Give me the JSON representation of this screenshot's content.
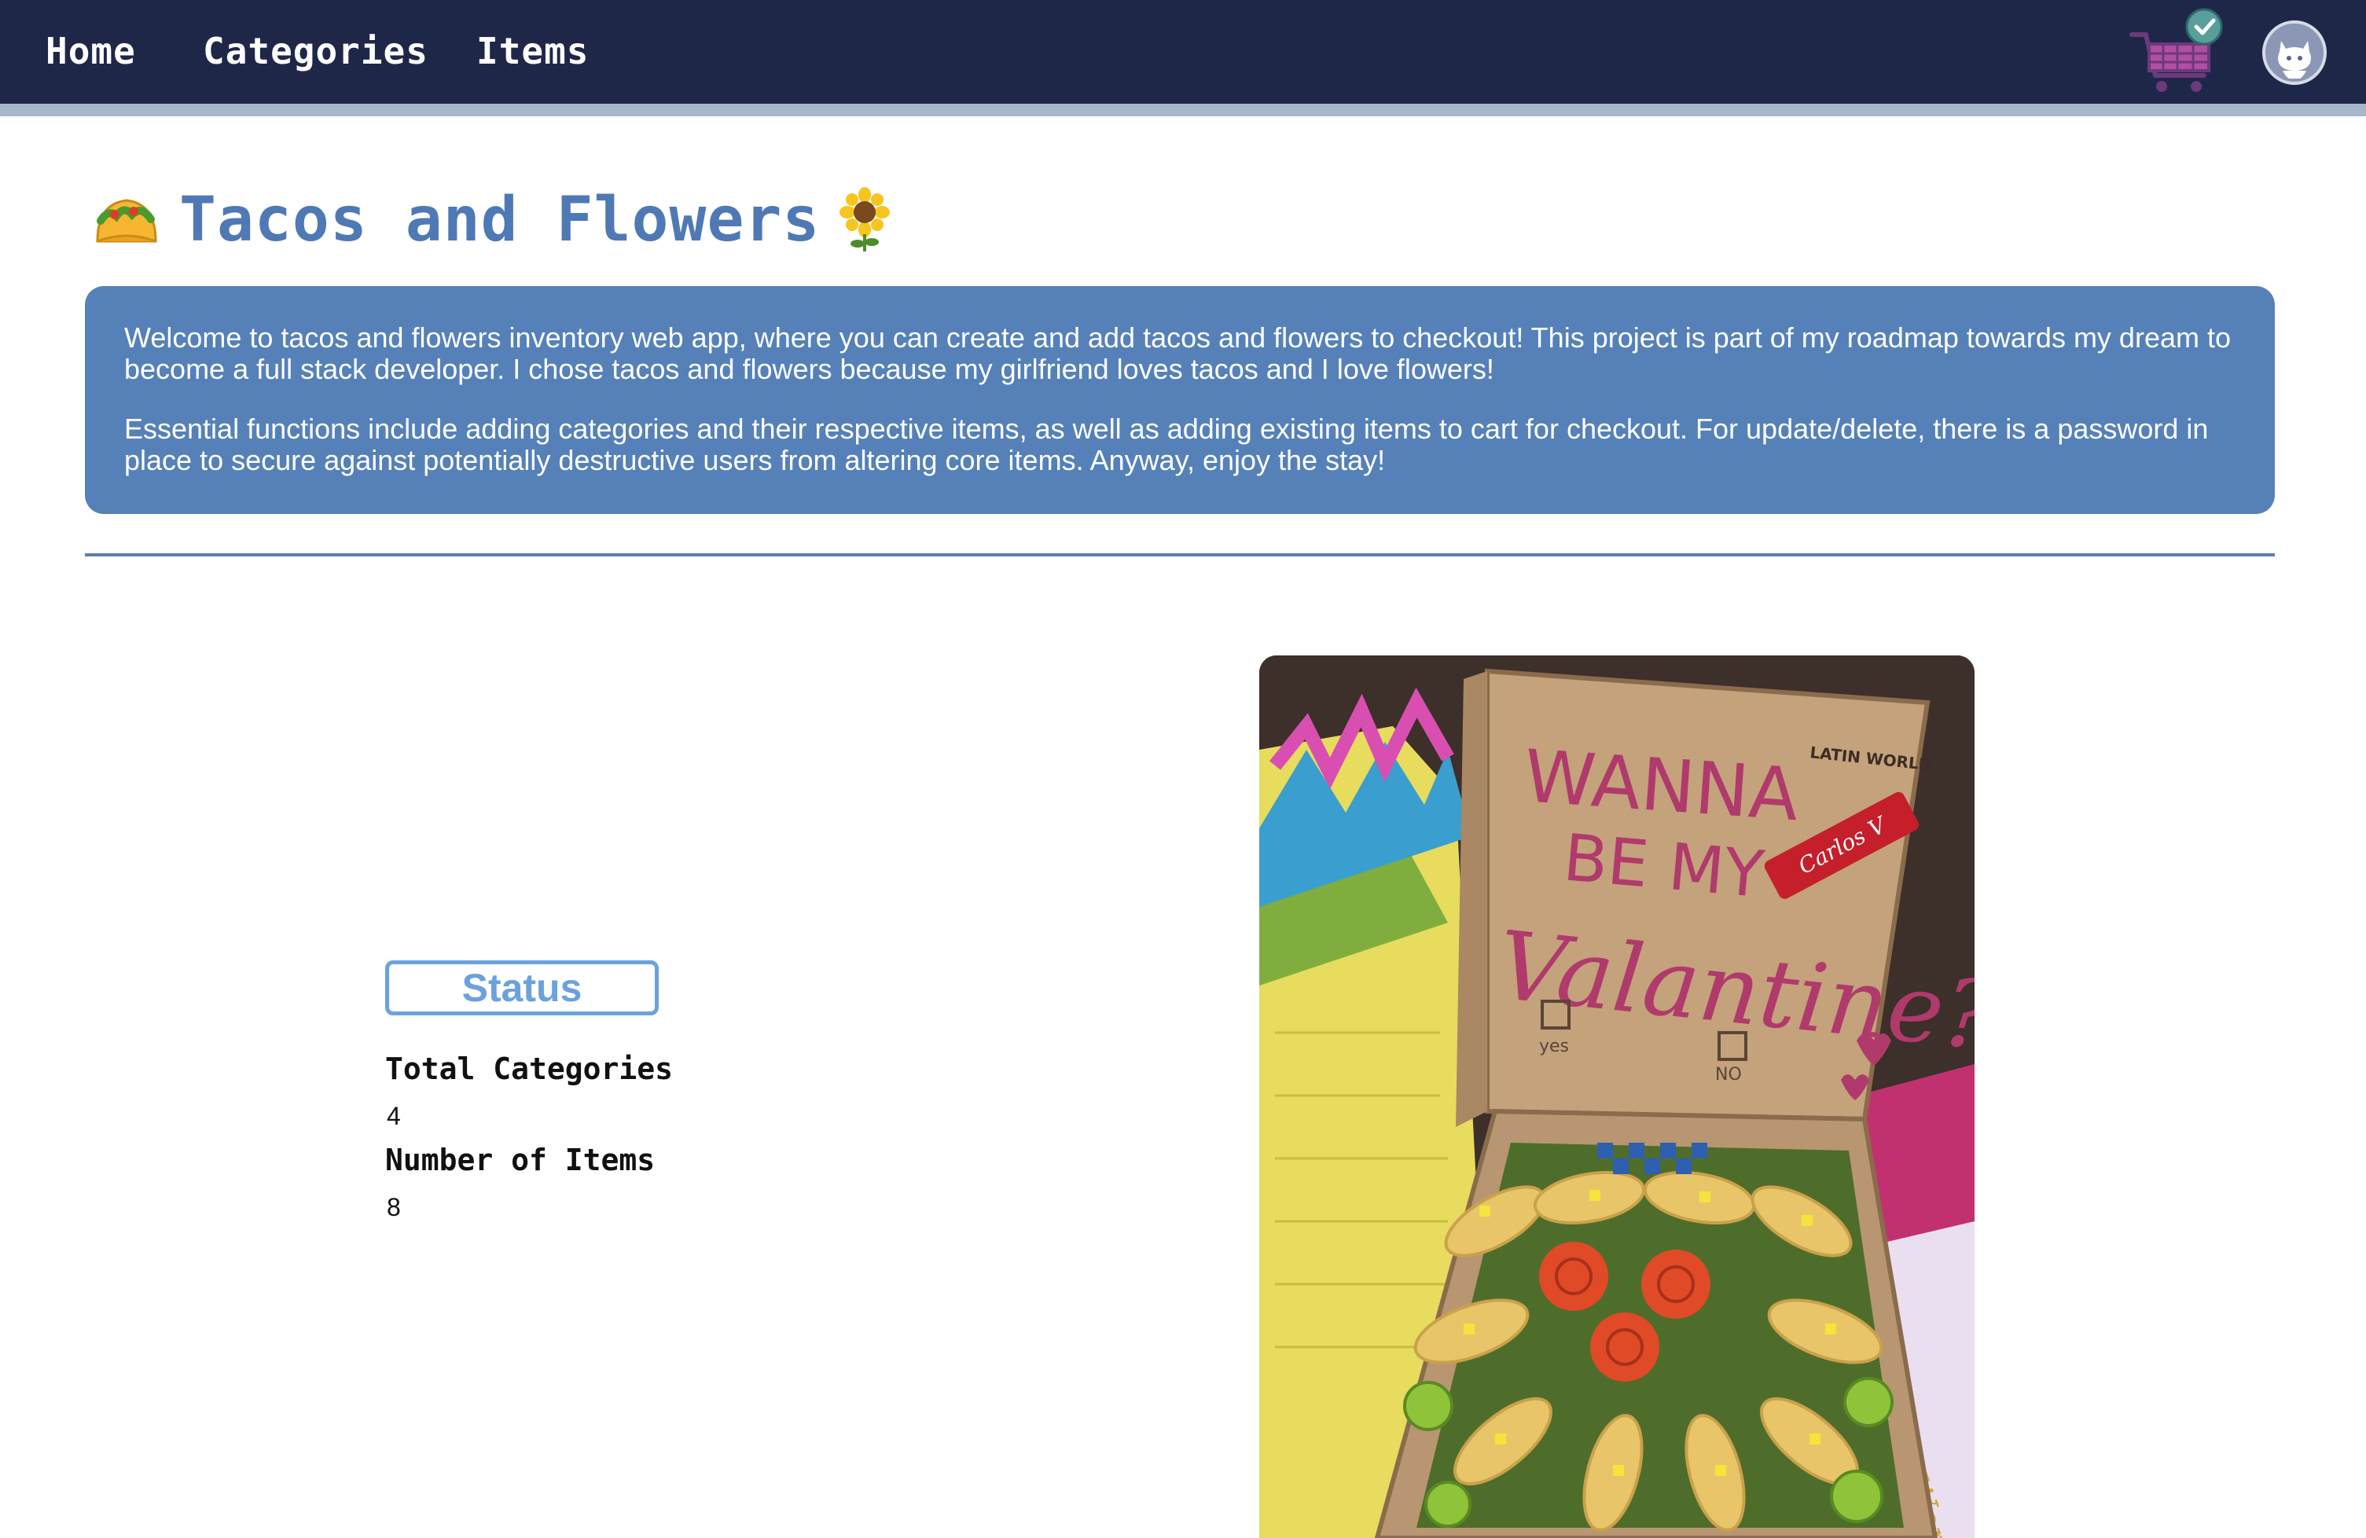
{
  "nav": {
    "home": "Home",
    "categories": "Categories",
    "items": "Items"
  },
  "icons": {
    "cart": "shopping-cart-icon",
    "checkmark": "check-badge-icon",
    "github": "github-icon",
    "taco": "taco-emoji",
    "sunflower": "sunflower-emoji"
  },
  "header": {
    "title": "Tacos and Flowers",
    "title_prefix_emoji": "🌮",
    "title_suffix_emoji": "🌻"
  },
  "intro": {
    "paragraph1": "Welcome to tacos and flowers inventory web app, where you can create and add tacos and flowers to checkout! This project is part of my roadmap towards my dream to become a full stack developer. I chose tacos and flowers because my girlfriend loves tacos and I love flowers!",
    "paragraph2": "Essential functions include adding categories and their respective items, as well as adding existing items to cart for checkout. For update/delete, there is a password in place to secure against potentially destructive users from altering core items. Anyway, enjoy the stay!"
  },
  "status": {
    "heading": "Status",
    "total_categories_label": "Total Categories",
    "total_categories_value": "4",
    "number_of_items_label": "Number of Items",
    "number_of_items_value": "8"
  },
  "photo": {
    "line1": "WANNA",
    "line2": "BE MY",
    "line3": "Valantine?",
    "yes_label": "yes",
    "no_label": "NO",
    "brand": "LATIN WORLD",
    "candy": "Carlos V"
  },
  "colors": {
    "navbar": "#1f2749",
    "navbar_border": "#a8b6cc",
    "title": "#4f79b5",
    "intro_bg": "#5581b8",
    "status_accent": "#6ba2dd"
  }
}
